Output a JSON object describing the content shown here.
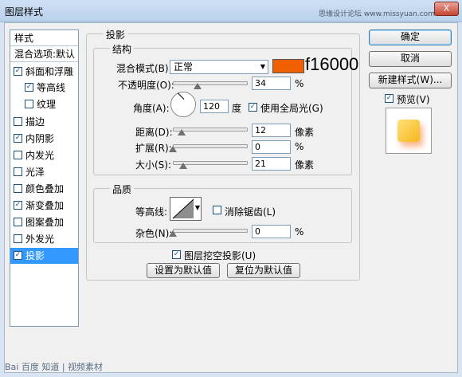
{
  "window": {
    "title": "图层样式",
    "watermark": "思缘设计论坛 www.missyuan.com",
    "close": "X"
  },
  "style_list": {
    "header": "样式",
    "blend_options": "混合选项:默认",
    "items": [
      {
        "label": "斜面和浮雕",
        "checked": true
      },
      {
        "label": "等高线",
        "checked": true,
        "sub": true
      },
      {
        "label": "纹理",
        "checked": false,
        "sub": true
      },
      {
        "label": "描边",
        "checked": false
      },
      {
        "label": "内阴影",
        "checked": true
      },
      {
        "label": "内发光",
        "checked": false
      },
      {
        "label": "光泽",
        "checked": false
      },
      {
        "label": "颜色叠加",
        "checked": false
      },
      {
        "label": "渐变叠加",
        "checked": true
      },
      {
        "label": "图案叠加",
        "checked": false
      },
      {
        "label": "外发光",
        "checked": false
      },
      {
        "label": "投影",
        "checked": true,
        "selected": true
      }
    ]
  },
  "drop_shadow": {
    "section_title": "投影",
    "structure_title": "结构",
    "blend_mode_label": "混合模式(B):",
    "blend_mode_value": "正常",
    "color": "#f16000",
    "color_annotation": "f16000",
    "opacity_label": "不透明度(O):",
    "opacity_value": "34",
    "opacity_unit": "%",
    "angle_label": "角度(A):",
    "angle_value": "120",
    "angle_unit": "度",
    "global_light_label": "使用全局光(G)",
    "global_light_checked": true,
    "distance_label": "距离(D):",
    "distance_value": "12",
    "distance_unit": "像素",
    "spread_label": "扩展(R):",
    "spread_value": "0",
    "spread_unit": "%",
    "size_label": "大小(S):",
    "size_value": "21",
    "size_unit": "像素",
    "quality_title": "品质",
    "contour_label": "等高线:",
    "anti_alias_label": "消除锯齿(L)",
    "anti_alias_checked": false,
    "noise_label": "杂色(N):",
    "noise_value": "0",
    "noise_unit": "%",
    "knockout_label": "图层挖空投影(U)",
    "knockout_checked": true,
    "make_default_label": "设置为默认值",
    "reset_default_label": "复位为默认值"
  },
  "buttons": {
    "ok": "确定",
    "cancel": "取消",
    "new_style": "新建样式(W)...",
    "preview_label": "预览(V)",
    "preview_checked": true
  },
  "footer": {
    "watermark": "Bai 百度 知道 | 视频素材"
  }
}
